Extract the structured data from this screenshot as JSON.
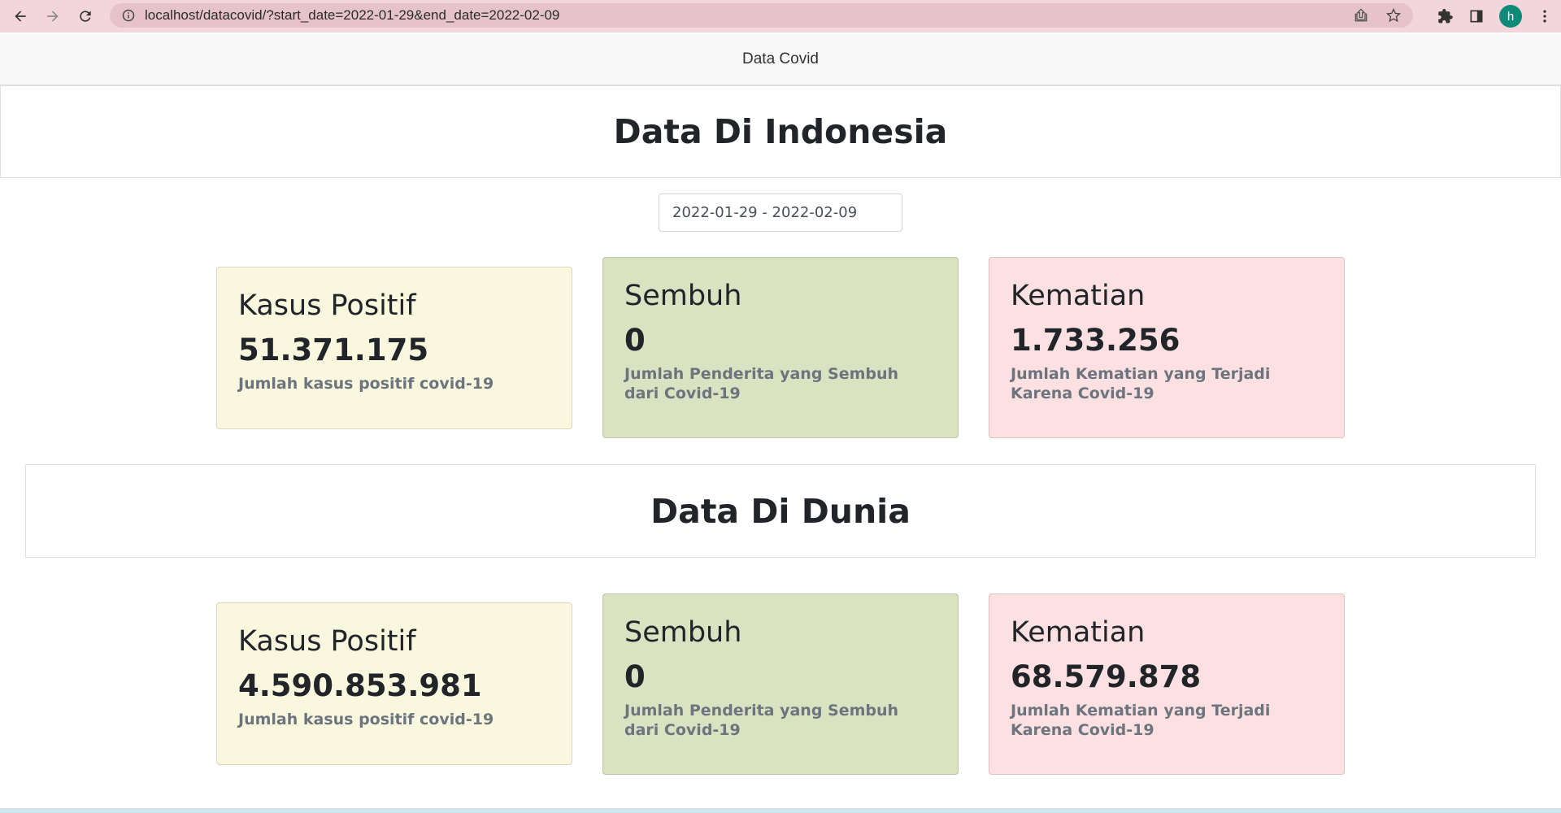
{
  "browser": {
    "url": "localhost/datacovid/?start_date=2022-01-29&end_date=2022-02-09",
    "avatar_letter": "h"
  },
  "navbar": {
    "brand": "Data Covid"
  },
  "indonesia": {
    "title": "Data Di Indonesia",
    "date_range": "2022-01-29 - 2022-02-09",
    "positif": {
      "title": "Kasus Positif",
      "value": "51.371.175",
      "desc": "Jumlah kasus positif covid-19"
    },
    "sembuh": {
      "title": "Sembuh",
      "value": "0",
      "desc": "Jumlah Penderita yang Sembuh dari Covid-19"
    },
    "kematian": {
      "title": "Kematian",
      "value": "1.733.256",
      "desc": "Jumlah Kematian yang Terjadi Karena Covid-19"
    }
  },
  "dunia": {
    "title": "Data Di Dunia",
    "positif": {
      "title": "Kasus Positif",
      "value": "4.590.853.981",
      "desc": "Jumlah kasus positif covid-19"
    },
    "sembuh": {
      "title": "Sembuh",
      "value": "0",
      "desc": "Jumlah Penderita yang Sembuh dari Covid-19"
    },
    "kematian": {
      "title": "Kematian",
      "value": "68.579.878",
      "desc": "Jumlah Kematian yang Terjadi Karena Covid-19"
    }
  },
  "colors": {
    "positif_bg": "#f9f7de",
    "sembuh_bg": "#d9e2c1",
    "kematian_bg": "#fde0e2",
    "browser_bar": "#f3d6dc"
  }
}
